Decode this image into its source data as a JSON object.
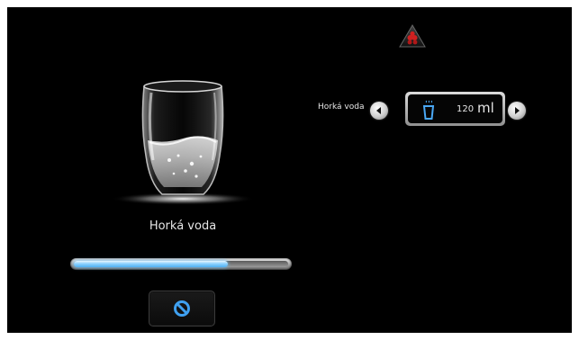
{
  "drink": {
    "name": "Horká voda"
  },
  "progress": {
    "fraction": 0.72
  },
  "selector": {
    "label": "Horká voda",
    "volume_value": "120",
    "volume_unit": "ml"
  },
  "icons": {
    "warning": "warning-icon",
    "cancel": "cancel-icon",
    "prev": "left-arrow-icon",
    "next": "right-arrow-icon",
    "cup": "hot-cup-icon"
  },
  "colors": {
    "accent_blue": "#2f8fe8",
    "warning_red": "#cc1e1e",
    "background": "#000000"
  }
}
